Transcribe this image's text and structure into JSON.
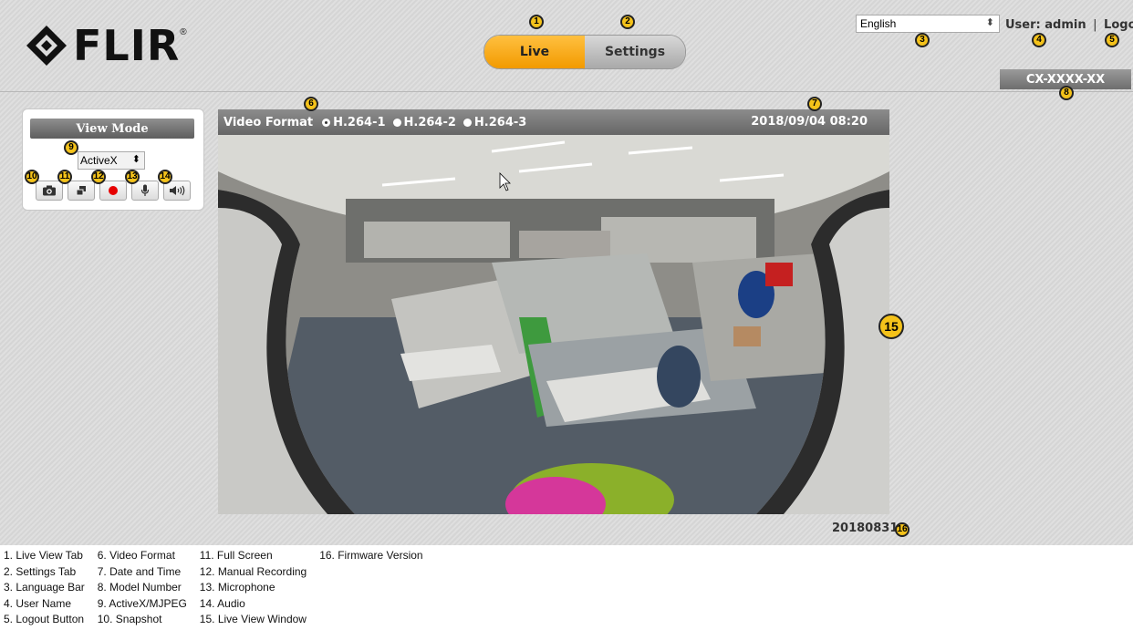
{
  "logo": {
    "text": "FLIR",
    "reg": "®"
  },
  "tabs": {
    "live": "Live",
    "settings": "Settings"
  },
  "language": {
    "selected": "English",
    "arrows": "⬍"
  },
  "user": {
    "label": "User: admin",
    "separator": "|",
    "logout": "Logout"
  },
  "model_number": "CX-XXXX-XX",
  "view_mode": {
    "button": "View Mode",
    "selected": "ActiveX",
    "arrows": "⬍"
  },
  "video": {
    "format_label": "Video Format",
    "formats": [
      "H.264-1",
      "H.264-2",
      "H.264-3"
    ],
    "selected_format": "H.264-1",
    "datetime": "2018/09/04 08:20"
  },
  "firmware": "20180831",
  "icons": [
    "snapshot-icon",
    "full-screen-icon",
    "record-icon",
    "microphone-icon",
    "audio-icon"
  ],
  "colors": {
    "live_tab": "#f5a623",
    "record": "#e60000",
    "callout": "#f4c21a"
  },
  "callouts": [
    "1",
    "2",
    "3",
    "4",
    "5",
    "6",
    "7",
    "8",
    "9",
    "10",
    "11",
    "12",
    "13",
    "14",
    "15",
    "16"
  ],
  "legend": [
    [
      "1. Live View Tab",
      "2. Settings Tab",
      "3. Language Bar",
      "4. User Name",
      "5. Logout Button"
    ],
    [
      "6. Video Format",
      "7. Date and Time",
      "8. Model Number",
      "9. ActiveX/MJPEG",
      "10. Snapshot"
    ],
    [
      "11. Full Screen",
      "12. Manual Recording",
      "13. Microphone",
      "14. Audio",
      "15. Live View Window"
    ],
    [
      "16. Firmware Version"
    ]
  ]
}
